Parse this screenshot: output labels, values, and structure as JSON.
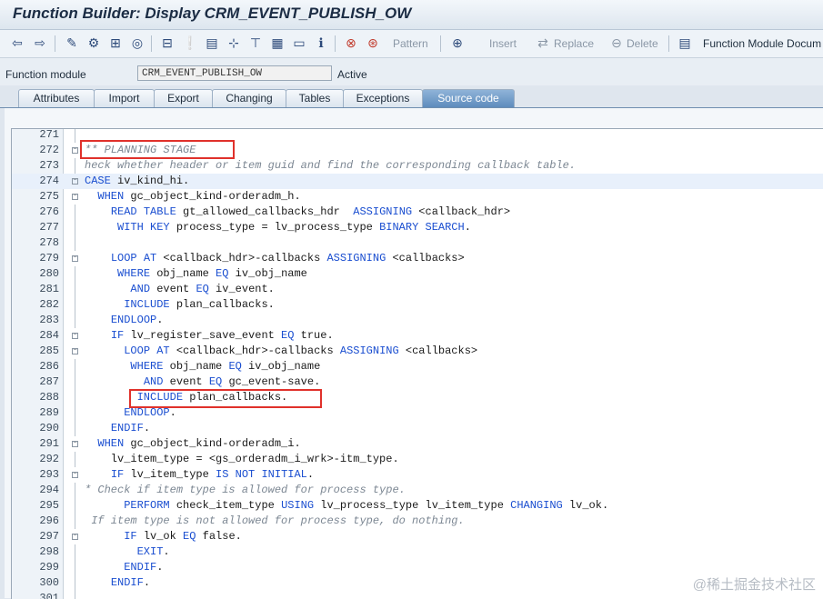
{
  "window": {
    "title": "Function Builder: Display CRM_EVENT_PUBLISH_OW"
  },
  "toolbar": {
    "icons": [
      "back-icon",
      "forward-icon",
      "edit-pencil-icon",
      "other-object-icon",
      "activate-icon",
      "where-used-icon",
      "display-object-list-icon",
      "find-icon",
      "inspect-icon",
      "info-icon"
    ],
    "pattern": "Pattern",
    "insert": "Insert",
    "replace": "Replace",
    "delete": "Delete",
    "doc": "Function Module Docum"
  },
  "header": {
    "label": "Function module",
    "value": "CRM_EVENT_PUBLISH_OW",
    "status": "Active"
  },
  "tabs": [
    "Attributes",
    "Import",
    "Export",
    "Changing",
    "Tables",
    "Exceptions",
    "Source code"
  ],
  "source": [
    {
      "n": "271",
      "t": ""
    },
    {
      "n": "272",
      "t": "** PLANNING STAGE"
    },
    {
      "n": "273",
      "t": "heck whether header or item guid and find the corresponding callback table."
    },
    {
      "n": "274",
      "t": "CASE iv_kind_hi."
    },
    {
      "n": "275",
      "t": "  WHEN gc_object_kind-orderadm_h."
    },
    {
      "n": "276",
      "t": "    READ TABLE gt_allowed_callbacks_hdr  ASSIGNING <callback_hdr>"
    },
    {
      "n": "277",
      "t": "     WITH KEY process_type = lv_process_type BINARY SEARCH."
    },
    {
      "n": "278",
      "t": ""
    },
    {
      "n": "279",
      "t": "    LOOP AT <callback_hdr>-callbacks ASSIGNING <callbacks>"
    },
    {
      "n": "280",
      "t": "     WHERE obj_name EQ iv_obj_name"
    },
    {
      "n": "281",
      "t": "       AND event EQ iv_event."
    },
    {
      "n": "282",
      "t": "      INCLUDE plan_callbacks."
    },
    {
      "n": "283",
      "t": "    ENDLOOP."
    },
    {
      "n": "284",
      "t": "    IF lv_register_save_event EQ true."
    },
    {
      "n": "285",
      "t": "      LOOP AT <callback_hdr>-callbacks ASSIGNING <callbacks>"
    },
    {
      "n": "286",
      "t": "       WHERE obj_name EQ iv_obj_name"
    },
    {
      "n": "287",
      "t": "         AND event EQ gc_event-save."
    },
    {
      "n": "288",
      "t": "        INCLUDE plan_callbacks."
    },
    {
      "n": "289",
      "t": "      ENDLOOP."
    },
    {
      "n": "290",
      "t": "    ENDIF."
    },
    {
      "n": "291",
      "t": "  WHEN gc_object_kind-orderadm_i."
    },
    {
      "n": "292",
      "t": "    lv_item_type = <gs_orderadm_i_wrk>-itm_type."
    },
    {
      "n": "293",
      "t": "    IF lv_item_type IS NOT INITIAL."
    },
    {
      "n": "294",
      "t": "* Check if item type is allowed for process type."
    },
    {
      "n": "295",
      "t": "      PERFORM check_item_type USING lv_process_type lv_item_type CHANGING lv_ok."
    },
    {
      "n": "296",
      "t": " If item type is not allowed for process type, do nothing."
    },
    {
      "n": "297",
      "t": "      IF lv_ok EQ false."
    },
    {
      "n": "298",
      "t": "        EXIT."
    },
    {
      "n": "299",
      "t": "      ENDIF."
    },
    {
      "n": "300",
      "t": "    ENDIF."
    },
    {
      "n": "301",
      "t": ""
    }
  ],
  "watermark": "@稀土掘金技术社区"
}
